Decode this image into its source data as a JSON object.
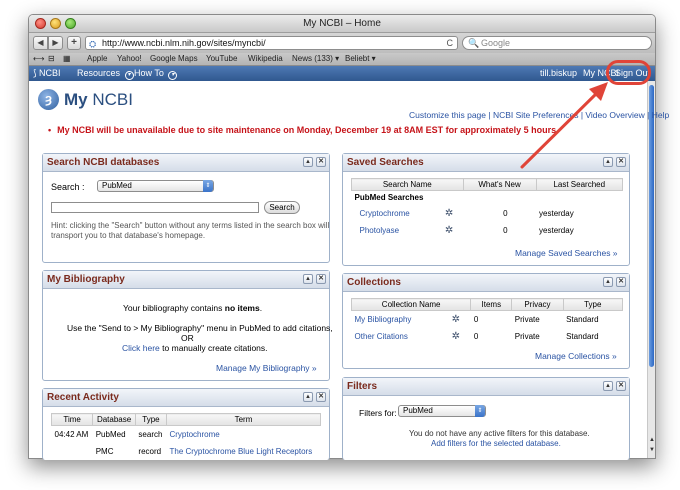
{
  "window": {
    "title": "My NCBI – Home"
  },
  "toolbar": {
    "back": "◀",
    "forward": "▶",
    "add": "+",
    "url": "http://www.ncbi.nlm.nih.gov/sites/myncbi/",
    "reload": "C",
    "search_placeholder": "Google"
  },
  "bookmarks": [
    "Apple",
    "Yahoo!",
    "Google Maps",
    "YouTube",
    "Wikipedia",
    "News (133) ▾",
    "Beliebt ▾"
  ],
  "ncbibar": {
    "logo": "NCBI",
    "resources": "Resources",
    "howto": "How To",
    "user": "till.biskup",
    "myncbi": "My NCBI",
    "signout": "Sign Out"
  },
  "logo": {
    "text_my": "My",
    "text_ncbi": "NCBI"
  },
  "toplinks": {
    "customize": "Customize this page",
    "prefs": "NCBI Site Preferences",
    "video": "Video Overview",
    "help": "Help"
  },
  "alert": "My NCBI will be unavailable due to site maintenance on Monday, December 19 at 8AM EST for approximately 5 hours.",
  "search_panel": {
    "title": "Search NCBI databases",
    "label": "Search :",
    "db": "PubMed",
    "button": "Search",
    "hint1": "Hint: clicking the \"Search\" button without any terms listed in the search box will",
    "hint2": "transport you to that database's homepage."
  },
  "biblio_panel": {
    "title": "My Bibliography",
    "line1a": "Your bibliography contains ",
    "line1b": "no items",
    "line1c": ".",
    "line2": "Use the \"Send to > My Bibliography\" menu in PubMed to add citations,",
    "line3": "OR",
    "line4a": "Click here",
    "line4b": " to manually create citations.",
    "manage": "Manage My Bibliography »"
  },
  "activity_panel": {
    "title": "Recent Activity",
    "headers": [
      "Time",
      "Database",
      "Type",
      "Term"
    ],
    "rows": [
      [
        "04:42 AM",
        "PubMed",
        "search",
        "Cryptochrome"
      ],
      [
        "",
        "PMC",
        "record",
        "The Cryptochrome Blue Light Receptors"
      ]
    ]
  },
  "saved_panel": {
    "title": "Saved Searches",
    "headers": [
      "Search Name",
      "What's New",
      "Last Searched"
    ],
    "group": "PubMed Searches",
    "rows": [
      [
        "Cryptochrome",
        "0",
        "yesterday"
      ],
      [
        "Photolyase",
        "0",
        "yesterday"
      ]
    ],
    "manage": "Manage Saved Searches »"
  },
  "collections_panel": {
    "title": "Collections",
    "headers": [
      "Collection Name",
      "Items",
      "Privacy",
      "Type"
    ],
    "rows": [
      [
        "My Bibliography",
        "0",
        "Private",
        "Standard"
      ],
      [
        "Other Citations",
        "0",
        "Private",
        "Standard"
      ]
    ],
    "manage": "Manage Collections »"
  },
  "filters_panel": {
    "title": "Filters",
    "label": "Filters for:",
    "db": "PubMed",
    "line1": "You do not have any active filters for this database.",
    "line2": "Add filters for the selected database."
  },
  "colors": {
    "ncbi_blue": "#30588f",
    "alert_red": "#c6141a",
    "link_blue": "#2a53a3",
    "annotation": "#e04438"
  }
}
